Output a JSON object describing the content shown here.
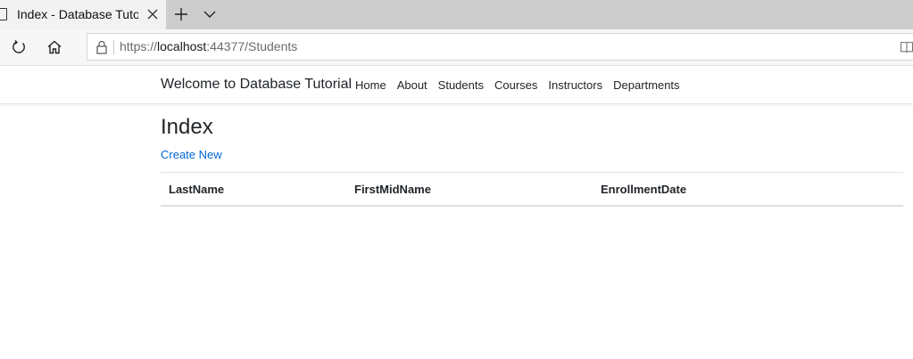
{
  "browser": {
    "tab_title": "Index - Database Tutori",
    "url_prefix": "https://",
    "url_host": "localhost",
    "url_rest": ":44377/Students"
  },
  "site": {
    "brand": "Welcome to Database Tutorial",
    "nav": [
      "Home",
      "About",
      "Students",
      "Courses",
      "Instructors",
      "Departments"
    ]
  },
  "main": {
    "title": "Index",
    "create_link": "Create New",
    "columns": [
      "LastName",
      "FirstMidName",
      "EnrollmentDate"
    ]
  },
  "icons": {
    "favicon": "page-icon",
    "tab_close": "close-icon",
    "new_tab": "plus-icon",
    "tab_list": "chevron-down-icon",
    "refresh": "refresh-icon",
    "home": "home-icon",
    "lock": "lock-icon",
    "reading_view": "reading-view-icon"
  },
  "colors": {
    "link": "#0366d6",
    "text": "#212529"
  }
}
